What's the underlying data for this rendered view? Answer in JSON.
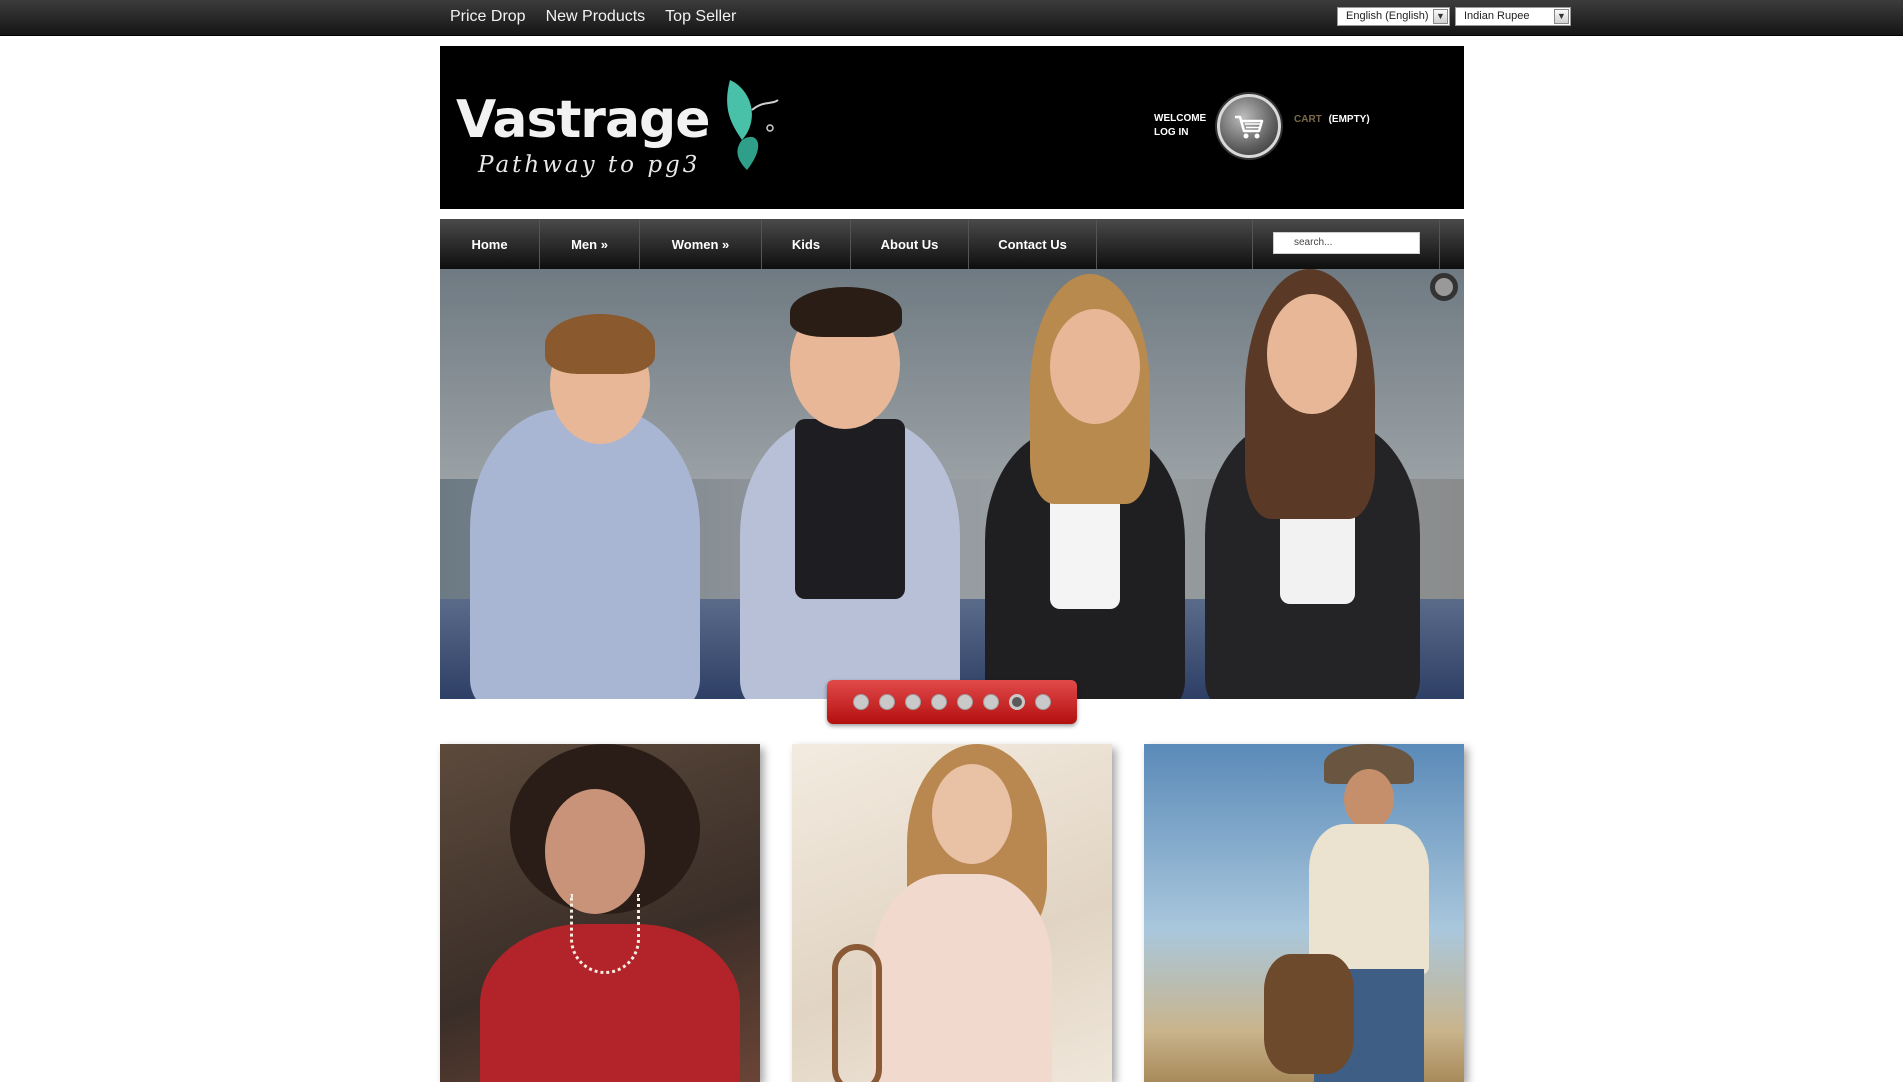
{
  "topbar": {
    "links": [
      "Price Drop",
      "New Products",
      "Top Seller"
    ],
    "language": "English (English)",
    "currency": "Indian Rupee"
  },
  "header": {
    "logo_text": "Vastrage",
    "logo_tagline": "Pathway to pg3",
    "welcome": "WELCOME",
    "login": "LOG IN",
    "cart_label": "CART",
    "cart_status": "(EMPTY)"
  },
  "nav": {
    "items": [
      "Home",
      "Men »",
      "Women »",
      "Kids",
      "About Us",
      "Contact Us"
    ],
    "search_placeholder": "search..."
  },
  "slider": {
    "slide_count": 8,
    "active_index": 6
  },
  "colors": {
    "pager_red": "#c21a1a",
    "header_bg": "#000000",
    "logo_accent": "#3fb8a0"
  }
}
